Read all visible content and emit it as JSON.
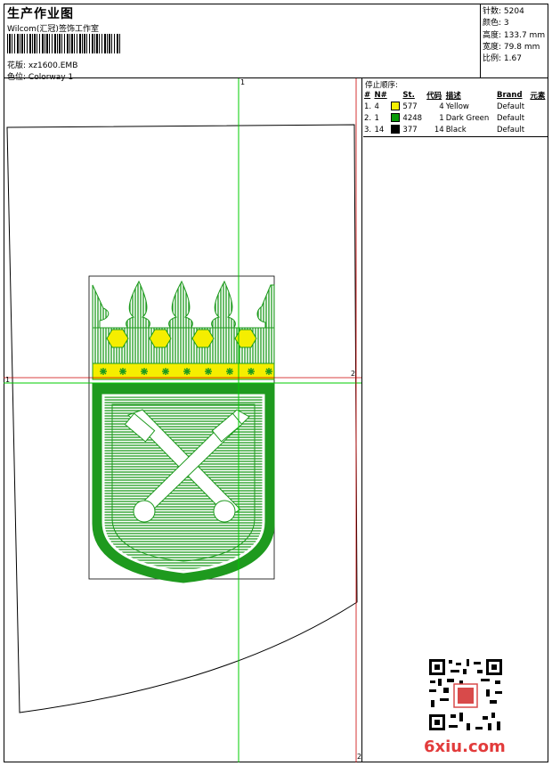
{
  "header": {
    "title": "生产作业图",
    "company": "Wilcom(汇冠)签饰工作室",
    "design_label": "花版:",
    "design_value": "xz1600.EMB",
    "colorway_label": "色位:",
    "colorway_value": "Colorway 1"
  },
  "stats": [
    {
      "label": "针数:",
      "value": "5204"
    },
    {
      "label": "颜色:",
      "value": "3"
    },
    {
      "label": "高度:",
      "value": "133.7 mm"
    },
    {
      "label": "宽度:",
      "value": "79.8 mm"
    },
    {
      "label": "比例:",
      "value": "1.67"
    }
  ],
  "legend": {
    "title": "停止顺序:",
    "columns": [
      "#",
      "N#",
      "St.",
      "代码",
      "描述",
      "Brand",
      "元素"
    ],
    "rows": [
      {
        "n": "1.",
        "code_n": "4",
        "color": "#f5f000",
        "stitches": "577",
        "code": "4",
        "desc": "Yellow",
        "brand": "Default"
      },
      {
        "n": "2.",
        "code_n": "1",
        "color": "#0a9a0a",
        "stitches": "4248",
        "code": "1",
        "desc": "Dark Green",
        "brand": "Default"
      },
      {
        "n": "3.",
        "code_n": "14",
        "color": "#000000",
        "stitches": "377",
        "code": "14",
        "desc": "Black",
        "brand": "Default"
      }
    ]
  },
  "guides": {
    "top": "1",
    "left": "1",
    "right": "2",
    "bottom": "2"
  },
  "colors": {
    "green": "#1e9a1e",
    "yellow": "#f5ee00",
    "guide_green": "#00cc00",
    "guide_red": "#cc0000"
  },
  "watermark": {
    "text": "6xiu.com"
  }
}
